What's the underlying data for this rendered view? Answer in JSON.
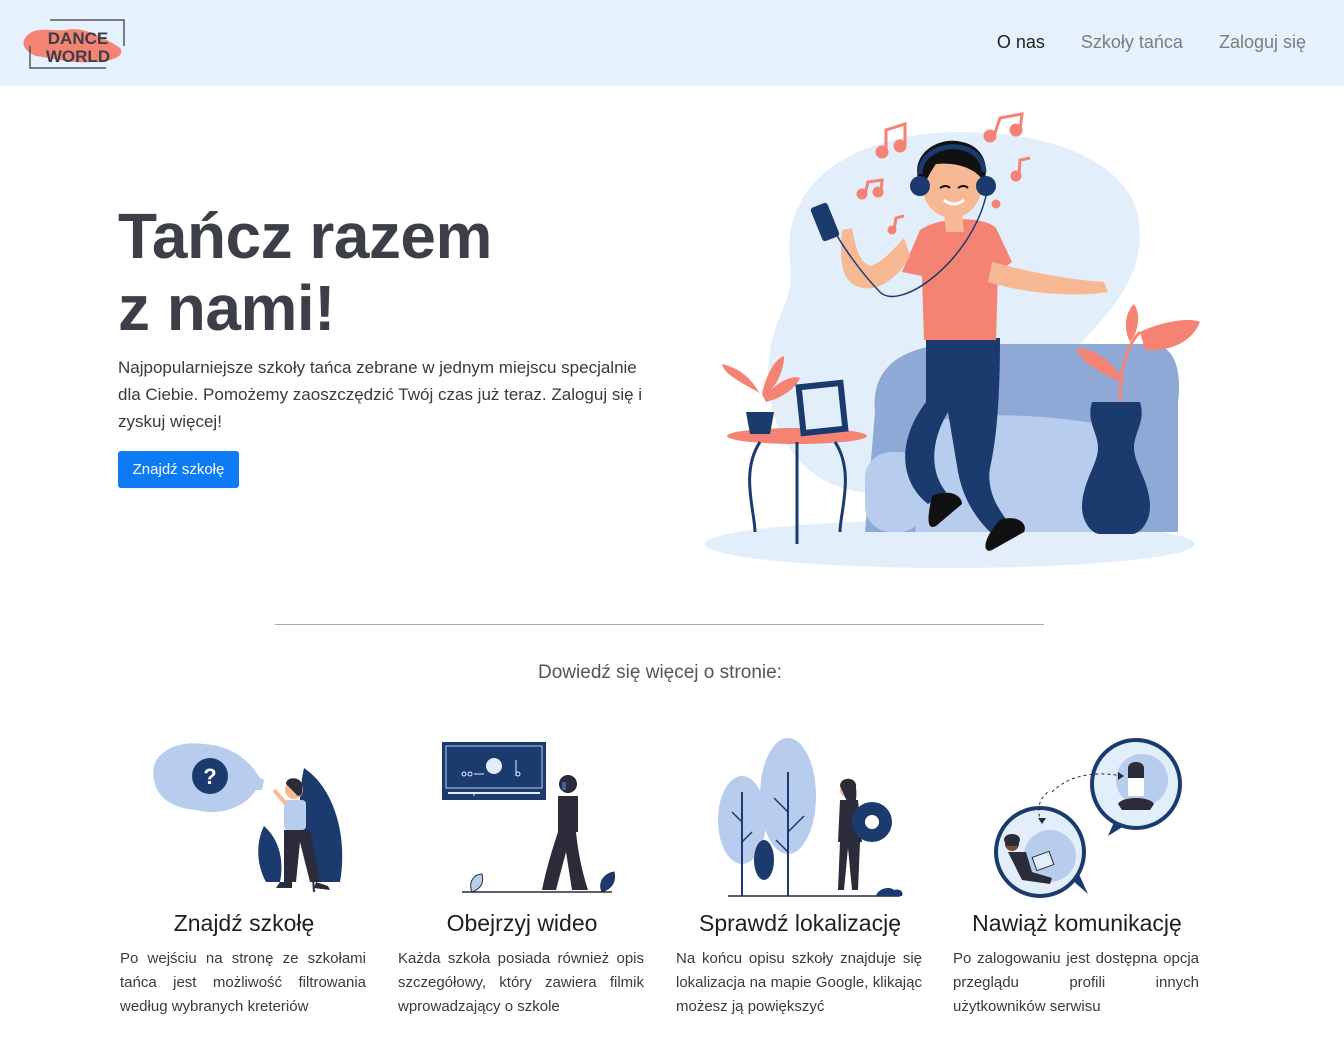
{
  "brand": {
    "line1": "DANCE",
    "line2": "WORLD"
  },
  "nav": {
    "items": [
      {
        "label": "O nas"
      },
      {
        "label": "Szkoły tańca"
      },
      {
        "label": "Zaloguj się"
      }
    ]
  },
  "hero": {
    "title_line1": "Tańcz razem",
    "title_line2": "z nami!",
    "description": "Najpopularniejsze szkoły tańca zebrane w jednym miejscu specjalnie dla Ciebie. Pomożemy zaoszczędzić Twój czas już teraz. Zaloguj się i zyskuj więcej!",
    "button_label": "Znajdź szkołę"
  },
  "section_title": "Dowiedź się więcej o stronie:",
  "features": [
    {
      "title": "Znajdź szkołę",
      "text": "Po wejściu na stronę ze szkołami tańca jest możliwość filtrowania według wybranych kreteriów"
    },
    {
      "title": "Obejrzyj wideo",
      "text": "Każda szkoła posiada również opis szczegółowy, który zawiera filmik wprowadzający o szkole"
    },
    {
      "title": "Sprawdź lokalizację",
      "text": "Na końcu opisu szkoły znajduje się lokalizacja na mapie Google, klikając możesz ją powiększyć"
    },
    {
      "title": "Nawiąż komunikację",
      "text": "Po zalogowaniu jest dostępna opcja przeglądu profili innych użytkowników serwisu"
    }
  ],
  "colors": {
    "navbar_bg": "#e5f1fd",
    "accent": "#0d7bf4",
    "brand_coral": "#f58373",
    "illustration_navy": "#1b3a6e",
    "illustration_light": "#b8ccee"
  }
}
